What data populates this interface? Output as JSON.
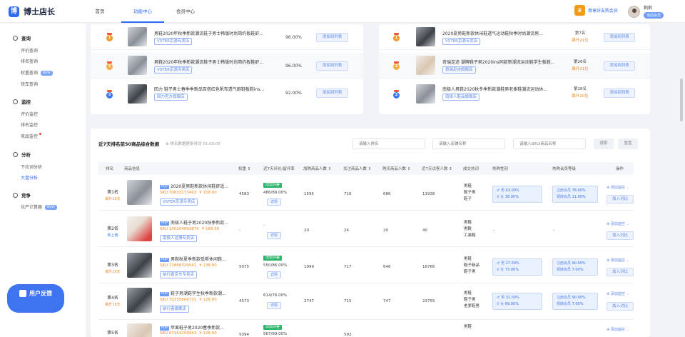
{
  "brand": {
    "name": "博士店长",
    "mark": "博"
  },
  "nav": {
    "items": [
      "首页",
      "功能中心",
      "会员中心"
    ],
    "active": 1
  },
  "vip": {
    "label": "尊享好友购会员"
  },
  "user": {
    "name": "莉莉",
    "badge": "当前会员"
  },
  "sidebar": {
    "sections": [
      {
        "title": "查询",
        "items": [
          {
            "label": "评价查询"
          },
          {
            "label": "排名查询"
          },
          {
            "label": "权重查询",
            "badge": "NEW"
          },
          {
            "label": "快车查询"
          }
        ]
      },
      {
        "title": "监控",
        "items": [
          {
            "label": "评价监控"
          },
          {
            "label": "排名监控"
          },
          {
            "label": "竞品监控",
            "dot": true
          }
        ]
      },
      {
        "title": "分析",
        "items": [
          {
            "label": "下拉词分析"
          },
          {
            "label": "大盘分析",
            "active": true
          }
        ]
      },
      {
        "title": "竞争",
        "items": [
          {
            "label": "坑产计算器",
            "badge": "NEW"
          }
        ]
      }
    ],
    "feedback": "用户反馈"
  },
  "left_panel": {
    "rows": [
      {
        "medal": "1",
        "name": "男鞋2020年秋季新款潮流鞋子男士韩版时尚简约板鞋舒...",
        "shop": "VSTER京源专卖店",
        "pct": "96.00%",
        "btn": "添加到列表"
      },
      {
        "medal": "2",
        "name": "男鞋2020年秋季新款潮流鞋子男士韩版时尚简约板鞋舒...",
        "shop": "VSTER京源专卖店",
        "pct": "96.00%",
        "btn": "添加到列表"
      },
      {
        "medal": "3",
        "name": "回力 鞋子男士春季季新品百搭红色帆布透气跑鞋板鞋ins...",
        "shop": "回力官方旗舰店",
        "pct": "92.00%",
        "btn": "添加到列表"
      }
    ]
  },
  "right_panel": {
    "rows": [
      {
        "medal": "1",
        "name": "2020夏男鞋新款休闲鞋透气运动鞋秋季时尚潮流男...",
        "shop": "VSTER京源专卖店",
        "rank": "第7名",
        "change": "飙升21位",
        "btn": "添加到列表"
      },
      {
        "medal": "2",
        "name": "奇瑞足迹 潮牌鞋子男2020ins同款新潮流运动鞋学生板鞋...",
        "shop": "奇瑞足迹旗舰店",
        "rank": "第26名",
        "change": "飙升21位",
        "btn": "添加到列表"
      },
      {
        "medal": "3",
        "name": "南极人男鞋2020秋冬季新款潮鞋男老爹鞋潮流运动休...",
        "shop": "南极人鞋品旗舰店",
        "rank": "第28名",
        "change": "飙升20位",
        "btn": "添加到列表"
      }
    ]
  },
  "main": {
    "title": "近7天排名前50商品综合数据",
    "time": "⊕ 排名数据更新时间 01:00:00",
    "filters": [
      {
        "placeholder": "请输入排名"
      },
      {
        "placeholder": "请输入店铺名称"
      },
      {
        "placeholder": "请输入SKU/商品名称"
      }
    ],
    "search_btn": "搜索",
    "reset_btn": "重置",
    "columns": [
      "排名",
      "商品信息",
      "权重 ⇕",
      "近7天评价/留评率",
      "加购商品人数 ⇕",
      "关注商品人数 ⇕",
      "购买商品人数 ⇕",
      "近7天访客人数 ⇕",
      "成交热词",
      "热购性别",
      "热购会员等级",
      "操作"
    ],
    "rows": [
      {
        "rank": "第1名",
        "sub": "飙升16天",
        "subblue": false,
        "name": "2020夏男鞋新款休闲鞋舒适...",
        "sku": "SKU 70633173493",
        "price": "¥ 108.00",
        "shop": "VSTER京源专卖店",
        "weight": "4583",
        "eval": "出现评差",
        "rate": "486/89.00%",
        "detail": "详情",
        "cart": "1595",
        "follow": "716",
        "buy": "686",
        "visit": "11938",
        "kw": [
          "男鞋",
          "鞋子男",
          "鞋子"
        ],
        "gender": [
          [
            "男",
            "63.00%"
          ],
          [
            "女",
            "38.00%"
          ]
        ],
        "level": [
          [
            "注册会员",
            "78.00%"
          ],
          [
            "铜牌会员",
            "11.00%"
          ]
        ],
        "op1": "添加监控",
        "op2": "加入对比"
      },
      {
        "rank": "第2名",
        "sub": "新上榜",
        "subblue": true,
        "name": "南极人鞋子男2020秋季新款...",
        "sku": "SKU 100204693874",
        "price": "¥ 168.00",
        "shop": "南极人运博专卖店",
        "weight": "-",
        "eval": "",
        "rate": "-",
        "detail": "详情",
        "cart": "20",
        "follow": "24",
        "buy": "20",
        "visit": "40",
        "kw": [
          "男鞋",
          "男靴",
          "工装鞋"
        ],
        "gender": [],
        "level": [],
        "op1": "添加监控",
        "op2": "加入对比"
      },
      {
        "rank": "第3名",
        "sub": "飙升16天",
        "subblue": false,
        "name": "男鞋秋夏季新款低帮休闲鞋...",
        "sku": "SKU 71866329541",
        "price": "¥ 138.00",
        "shop": "前行者京东专卖店",
        "weight": "5075",
        "eval": "出现评差",
        "rate": "550/86.00%",
        "detail": "详情",
        "cart": "1999",
        "follow": "717",
        "buy": "646",
        "visit": "16766",
        "kw": [
          "男鞋",
          "鞋子新品",
          "鞋子男"
        ],
        "gender": [
          [
            "男",
            "27.00%"
          ],
          [
            "女",
            "73.00%"
          ]
        ],
        "level": [
          [
            "注册会员",
            "90.00%"
          ],
          [
            "铜牌会员",
            "7.00%"
          ]
        ],
        "op1": "添加监控",
        "op2": "加入对比"
      },
      {
        "rank": "第4名",
        "sub": "飙升16天",
        "subblue": false,
        "name": "鞋子男潮鞋学生秋季新款潮...",
        "sku": "SKU 70155604731",
        "price": "¥ 128.00",
        "shop": "前行者旗舰店",
        "weight": "4573",
        "eval": "",
        "rate": "614/76.00%",
        "detail": "详情",
        "cart": "2747",
        "follow": "715",
        "buy": "747",
        "visit": "23755",
        "kw": [
          "男鞋",
          "鞋子男",
          "老爹鞋男"
        ],
        "gender": [
          [
            "男",
            "31.00%"
          ],
          [
            "女",
            "69.00%"
          ]
        ],
        "level": [
          [
            "注册会员",
            "90.00%"
          ],
          [
            "铜牌会员",
            "7.00%"
          ]
        ],
        "op1": "添加监控",
        "op2": "加入对比"
      },
      {
        "rank": "第5名",
        "sub": "",
        "subblue": false,
        "name": "苹果鞋子男2020春季新款...",
        "sku": "SKU 67361259943",
        "price": "¥ 128.00",
        "shop": "",
        "weight": "5094",
        "eval": "出现评差",
        "rate": "567/89.00%",
        "detail": "",
        "cart": "",
        "follow": "592",
        "buy": "",
        "visit": "",
        "kw": [
          "男鞋"
        ],
        "gender": [],
        "level": [],
        "op1": "添加监控",
        "op2": ""
      }
    ]
  }
}
